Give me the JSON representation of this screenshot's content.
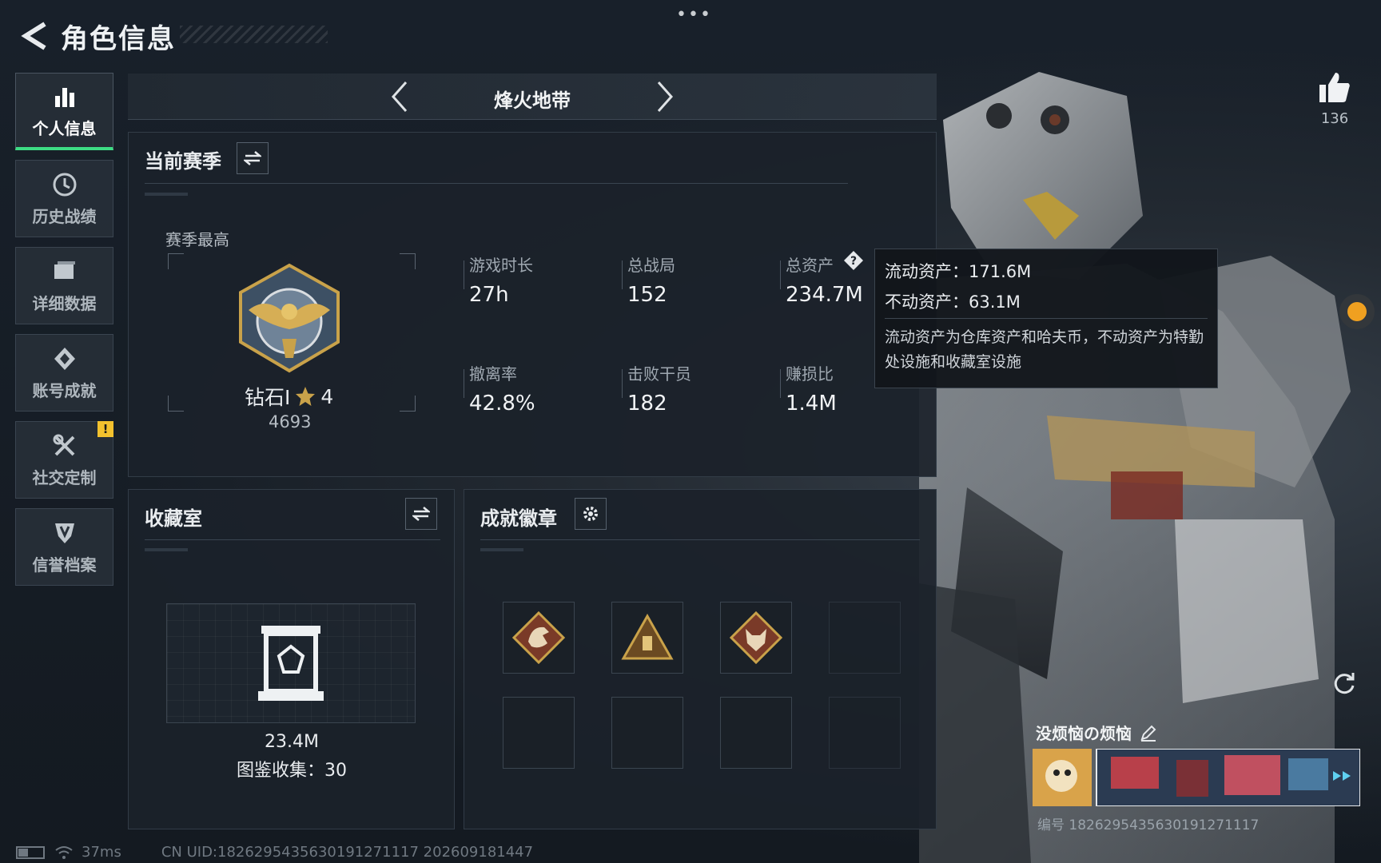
{
  "header": {
    "title": "角色信息"
  },
  "nav": {
    "items": [
      {
        "label": "个人信息",
        "icon": "bar-chart-icon",
        "active": true
      },
      {
        "label": "历史战绩",
        "icon": "clock-history-icon"
      },
      {
        "label": "详细数据",
        "icon": "folder-icon"
      },
      {
        "label": "账号成就",
        "icon": "medal-icon"
      },
      {
        "label": "社交定制",
        "icon": "tools-icon",
        "badge": "!"
      },
      {
        "label": "信誉档案",
        "icon": "shield-icon"
      }
    ]
  },
  "mode": {
    "label": "烽火地带"
  },
  "season": {
    "title": "当前赛季",
    "best_label": "赛季最高",
    "rank_name": "钻石I",
    "rank_stars": "4",
    "rank_points": "4693",
    "stats": [
      {
        "label": "游戏时长",
        "value": "27h"
      },
      {
        "label": "总战局",
        "value": "152"
      },
      {
        "label": "总资产",
        "value": "234.7M"
      },
      {
        "label": "撤离率",
        "value": "42.8%"
      },
      {
        "label": "击败干员",
        "value": "182"
      },
      {
        "label": "赚损比",
        "value": "1.4M"
      }
    ]
  },
  "tooltip": {
    "liquid": "流动资产：171.6M",
    "fixed": "不动资产：63.1M",
    "description": "流动资产为仓库资产和哈夫币，不动资产为特勤处设施和收藏室设施"
  },
  "collection": {
    "title": "收藏室",
    "value": "23.4M",
    "count_label": "图鉴收集：30"
  },
  "achievements": {
    "title": "成就徽章"
  },
  "likes": {
    "count": "136"
  },
  "player_card": {
    "name": "没烦恼の烦恼",
    "id": "编号 1826295435630191271117"
  },
  "footer": {
    "ping": "37ms",
    "uid": "CN UID:1826295435630191271117  202609181447"
  },
  "colors": {
    "accent_green": "#3ddc84",
    "warning": "#f2c12e",
    "gold": "#c9a24a"
  }
}
